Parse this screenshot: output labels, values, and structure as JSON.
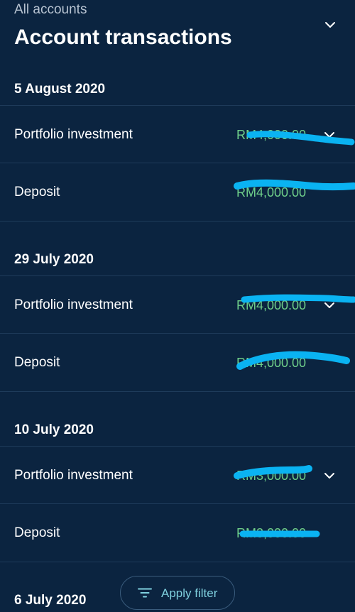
{
  "header": {
    "subtitle": "All accounts",
    "title": "Account transactions"
  },
  "sections": [
    {
      "date": "5 August 2020",
      "rows": [
        {
          "label": "Portfolio investment",
          "amount": "RM4,000.00",
          "expandable": true
        },
        {
          "label": "Deposit",
          "amount": "RM4,000.00",
          "expandable": false
        }
      ]
    },
    {
      "date": "29 July 2020",
      "rows": [
        {
          "label": "Portfolio investment",
          "amount": "RM4,000.00",
          "expandable": true
        },
        {
          "label": "Deposit",
          "amount": "RM4,000.00",
          "expandable": false
        }
      ]
    },
    {
      "date": "10 July 2020",
      "rows": [
        {
          "label": "Portfolio investment",
          "amount": "RM3,000.00",
          "expandable": true
        },
        {
          "label": "Deposit",
          "amount": "RM3,000.00",
          "expandable": false
        }
      ]
    },
    {
      "date": "6 July 2020",
      "rows": []
    }
  ],
  "filter_button": {
    "label": "Apply filter",
    "icon": "filter-icon"
  },
  "colors": {
    "background": "#0b2440",
    "divider": "#1e3b5a",
    "amount": "#6fcf8a",
    "accent": "#7fd0de",
    "redaction": "#0ab3f2"
  }
}
